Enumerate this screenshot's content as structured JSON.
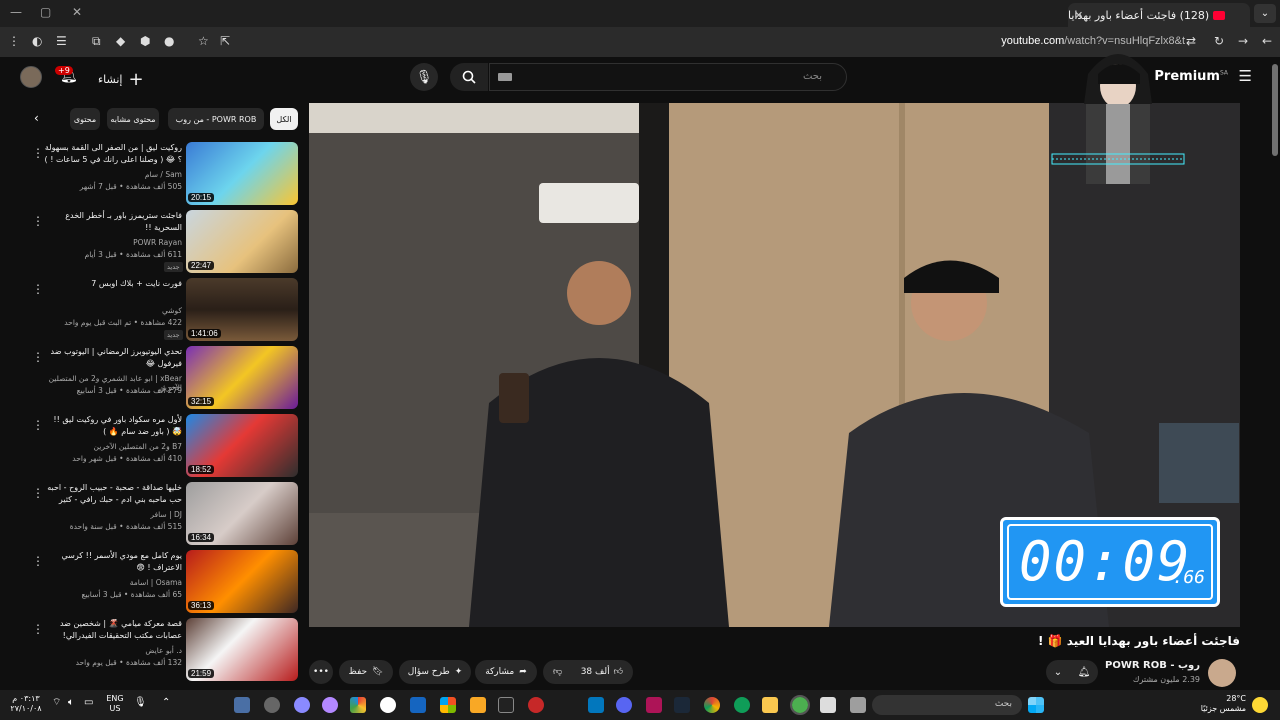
{
  "browser": {
    "tab_title": "(128) فاجئت أعضاء باور بهدايا",
    "url_host": "youtube.com",
    "url_path": "/watch?v=nsuHlqFzlx8&t"
  },
  "header": {
    "logo": "Premium",
    "logo_region": "SA",
    "create_label": "إنشاء",
    "notif_count": "+9",
    "search_placeholder": "بحث"
  },
  "chips": [
    {
      "label": "الكل"
    },
    {
      "label": "من روب - POWR ROB"
    },
    {
      "label": "محتوى مشابه"
    },
    {
      "label": "محتوى"
    }
  ],
  "recommendations": [
    {
      "title": "روكيت ليق | من الصفر الى القمة بسهولة ؟ 😂 ( وصلنا اعلى رانك في 5 ساعات ! ) ...",
      "channel": "Sam / سام",
      "meta": "505 ألف مشاهدة • قبل 7 أشهر",
      "duration": "20:15",
      "badge": ""
    },
    {
      "title": "فاجئت ستريمرز باور بـ أخطر الخدع السحرية !!",
      "channel": "POWR Rayan",
      "meta": "611 ألف مشاهدة • قبل 3 أيام",
      "duration": "22:47",
      "badge": "جديد"
    },
    {
      "title": "فورت نايت + بلاك اوبس 7",
      "channel": "كوشي",
      "meta": "422 مشاهدة • تم البث قبل يوم واحد",
      "duration": "1:41:06",
      "badge": "جديد"
    },
    {
      "title": "تحدي اليوتيوبرز الرمضاني | اليوتوب ضد فيرفول 😂",
      "channel": "xBear | ابو عابد الشمري و2 من المتصلين الآخرين",
      "meta": "279 ألف مشاهدة • قبل 3 أسابيع",
      "duration": "32:15",
      "badge": ""
    },
    {
      "title": "لأول مره سكواد باور في روكيت ليق !! 🤯 ( باور ضد سام 🔥 )",
      "channel": "B7 و2 من المتصلين الآخرين",
      "meta": "410 ألف مشاهدة • قبل شهر واحد",
      "duration": "18:52",
      "badge": ""
    },
    {
      "title": "خليها صداقة - صحبة - حبيب الروح - احبه حب ماحبه بني ادم - حبك رافي - كثير الشو...",
      "channel": "DJ | سافر",
      "meta": "515 ألف مشاهدة • قبل سنة واحدة",
      "duration": "16:34",
      "badge": ""
    },
    {
      "title": "يوم كامل مع مودي الأسمر !! كرسي الاعتراف ! 😨",
      "channel": "Osama | اسامة",
      "meta": "65 ألف مشاهدة • قبل 3 أسابيع",
      "duration": "36:13",
      "badge": ""
    },
    {
      "title": "قصة معركة ميامي 🌋 | شخصين ضد عصابات مكتب التحقيقات الفيدرالي!",
      "channel": "د. أبو عايض",
      "meta": "132 ألف مشاهدة • قبل يوم واحد",
      "duration": "21:59",
      "badge": ""
    }
  ],
  "stopwatch": {
    "main": "00:09",
    "centis": ".66"
  },
  "video": {
    "title": "فاجئت أعضاء باور بهدايا العيد 🎁 !",
    "channel_name": "روب - POWR ROB",
    "subscribers": "2.39 مليون مشترك",
    "likes": "38 ألف",
    "share_label": "مشاركة",
    "ask_label": "طرح سؤال",
    "save_label": "حفظ"
  },
  "taskbar": {
    "search_placeholder": "بحث",
    "weather_temp": "28°C",
    "weather_desc": "مشمس جزئيًا",
    "lang": "ENG",
    "region": "US",
    "time": "٠٣:١٣ م",
    "date": "٢٧/١٠/٠٨"
  },
  "colors": {
    "accent": "#ff0033",
    "stopwatch": "#2196f3"
  }
}
